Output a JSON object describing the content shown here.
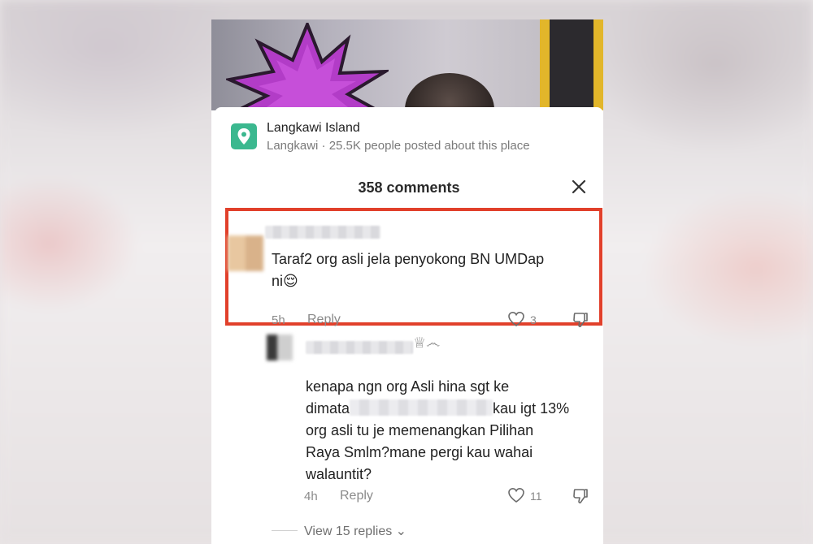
{
  "location": {
    "title": "Langkawi Island",
    "subtitle": "Langkawi · 25.5K people posted about this place",
    "icon": "location-pin-icon",
    "icon_color": "#3bb88f"
  },
  "comments_header": {
    "count_label": "358 comments",
    "close_icon": "close-icon"
  },
  "highlight_color": "#e1402b",
  "comments": [
    {
      "text_line1": "Taraf2 org asli jela penyokong BN UMDap",
      "text_line2": "ni😌",
      "time": "5h",
      "reply_label": "Reply",
      "likes": "3"
    },
    {
      "badge_icons": "♕෴",
      "text_line1": "kenapa ngn org Asli hina sgt ke",
      "text_line2_start": "dimata",
      "text_line2_end": "kau igt 13%",
      "text_line3": "org asli tu je memenangkan Pilihan",
      "text_line4": "Raya Smlm?mane pergi kau wahai",
      "text_line5": "walauntit?",
      "time": "4h",
      "reply_label": "Reply",
      "likes": "11"
    }
  ],
  "view_replies_label": "View 15 replies ⌄"
}
